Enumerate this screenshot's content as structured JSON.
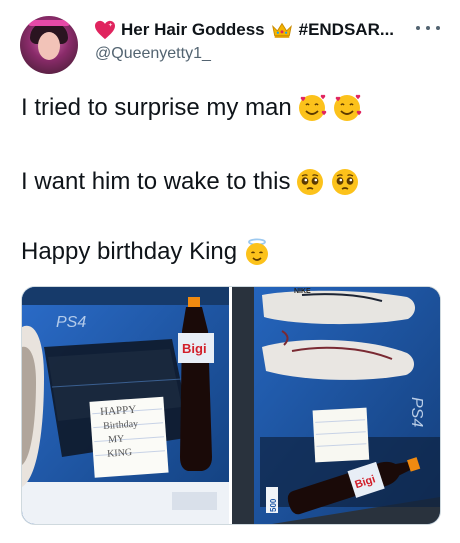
{
  "author": {
    "display_name": "Her Hair Goddess",
    "hashtag": "#ENDSAR...",
    "handle": "@Queenyetty1_"
  },
  "icons": [
    "sparkling-heart-icon",
    "crown-icon",
    "more-icon",
    "smiling-face-with-hearts-icon",
    "pleading-face-icon",
    "angel-face-icon"
  ],
  "tweet": {
    "line1": "I tried to surprise my man",
    "line2": "I want him to wake to this",
    "line3": "Happy birthday King"
  },
  "photos": {
    "left": {
      "console_logo": "PS4",
      "bottle_label": "Bigi",
      "note": [
        "HAPPY",
        "Birthday",
        "MY",
        "KING"
      ]
    },
    "right": {
      "shoe_brand": "NIKE",
      "console_logo": "PS4",
      "box_label": "500",
      "bottle_label": "Bigi"
    }
  },
  "colors": {
    "text": "#0f1419",
    "secondary": "#536471",
    "ps4_blue": "#1d56a6"
  }
}
